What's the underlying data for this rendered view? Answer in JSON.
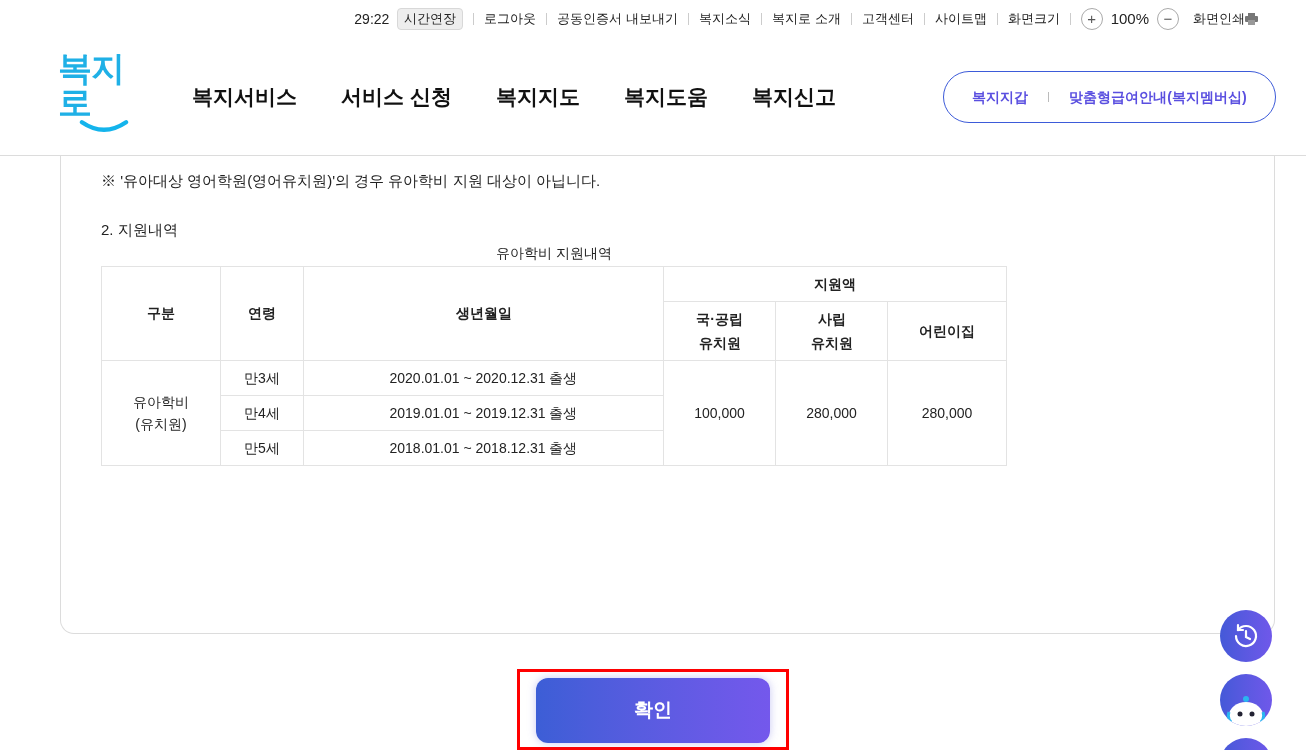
{
  "utility_bar": {
    "timer": "29:22",
    "extend_button": "시간연장",
    "links": [
      "로그아웃",
      "공동인증서 내보내기",
      "복지소식",
      "복지로 소개",
      "고객센터",
      "사이트맵",
      "화면크기"
    ],
    "zoom_in": "+",
    "zoom_level": "100%",
    "zoom_out": "−",
    "print": "화면인쇄"
  },
  "logo": "복지로",
  "nav": [
    "복지서비스",
    "서비스 신청",
    "복지지도",
    "복지도움",
    "복지신고"
  ],
  "quick_links": [
    "복지지갑",
    "맞춤형급여안내(복지멤버십)"
  ],
  "notes": [
    "※ '유아대상 영어학원(영어유치원)'의 경우 유아학비 지원 대상이 아닙니다."
  ],
  "section_title": "2. 지원내역",
  "table": {
    "caption": "유아학비 지원내역",
    "headers": {
      "category": "구분",
      "age": "연령",
      "birth": "생년월일",
      "amount": "지원액",
      "sub": [
        "국·공립\n유치원",
        "사립\n유치원",
        "어린이집"
      ]
    },
    "category": "유아학비\n(유치원)",
    "rows": [
      {
        "age": "만3세",
        "birth": "2020.01.01 ~ 2020.12.31 출생"
      },
      {
        "age": "만4세",
        "birth": "2019.01.01 ~ 2019.12.31 출생"
      },
      {
        "age": "만5세",
        "birth": "2018.01.01 ~ 2018.12.31 출생"
      }
    ],
    "amounts": [
      "100,000",
      "280,000",
      "280,000"
    ]
  },
  "confirm_button": "확인"
}
